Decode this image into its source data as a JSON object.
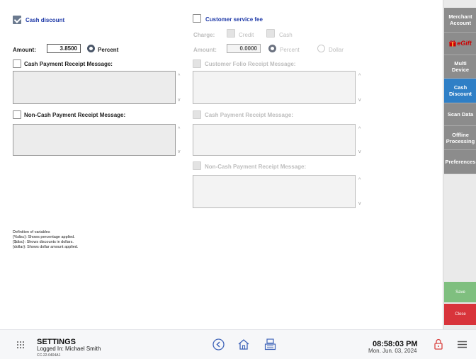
{
  "cash_discount": {
    "label": "Cash discount",
    "checked": true,
    "amount_label": "Amount:",
    "amount_value": "3.8500",
    "percent_label": "Percent",
    "cash_receipt_label": "Cash Payment Receipt Message:",
    "noncash_receipt_label": "Non-Cash Payment Receipt Message:"
  },
  "customer_service_fee": {
    "label": "Customer service fee",
    "checked": false,
    "charge_label": "Charge:",
    "credit_label": "Credit",
    "cash_label": "Cash",
    "amount_label": "Amount:",
    "amount_value": "0.0000",
    "percent_label": "Percent",
    "dollar_label": "Dollar",
    "folio_receipt_label": "Customer Folio Receipt Message:",
    "cash_receipt_label": "Cash Payment Receipt Message:",
    "noncash_receipt_label": "Non-Cash Payment Receipt Message:"
  },
  "definitions": {
    "line1": "Definition of variables",
    "line2": "{%disc}: Shows percentage applied.",
    "line3": "{$disc}:  Shows discounts in dollars.",
    "line4": "{dollar}: Shows dollar amount applied."
  },
  "sidebar": {
    "items": [
      {
        "label": "Merchant\nAccount"
      },
      {
        "label": "eGift"
      },
      {
        "label": "Multi\nDevice"
      },
      {
        "label": "Cash\nDiscount"
      },
      {
        "label": "Scan Data"
      },
      {
        "label": "Offline\nProcessing"
      },
      {
        "label": "Preferences"
      }
    ],
    "save_label": "Save",
    "close_label": "Close",
    "colors": {
      "active": "#2f7fc6",
      "save": "#7fbf7f",
      "close": "#d8343b"
    }
  },
  "bottom": {
    "title": "SETTINGS",
    "logged_in": "Logged In:  Michael Smith",
    "device_id": "CC-22-0404A1",
    "time": "08:58:03 PM",
    "date": "Mon. Jun. 03, 2024"
  },
  "icons": [
    "grid-icon",
    "back-icon",
    "home-icon",
    "register-icon",
    "lock-icon",
    "menu-icon"
  ]
}
